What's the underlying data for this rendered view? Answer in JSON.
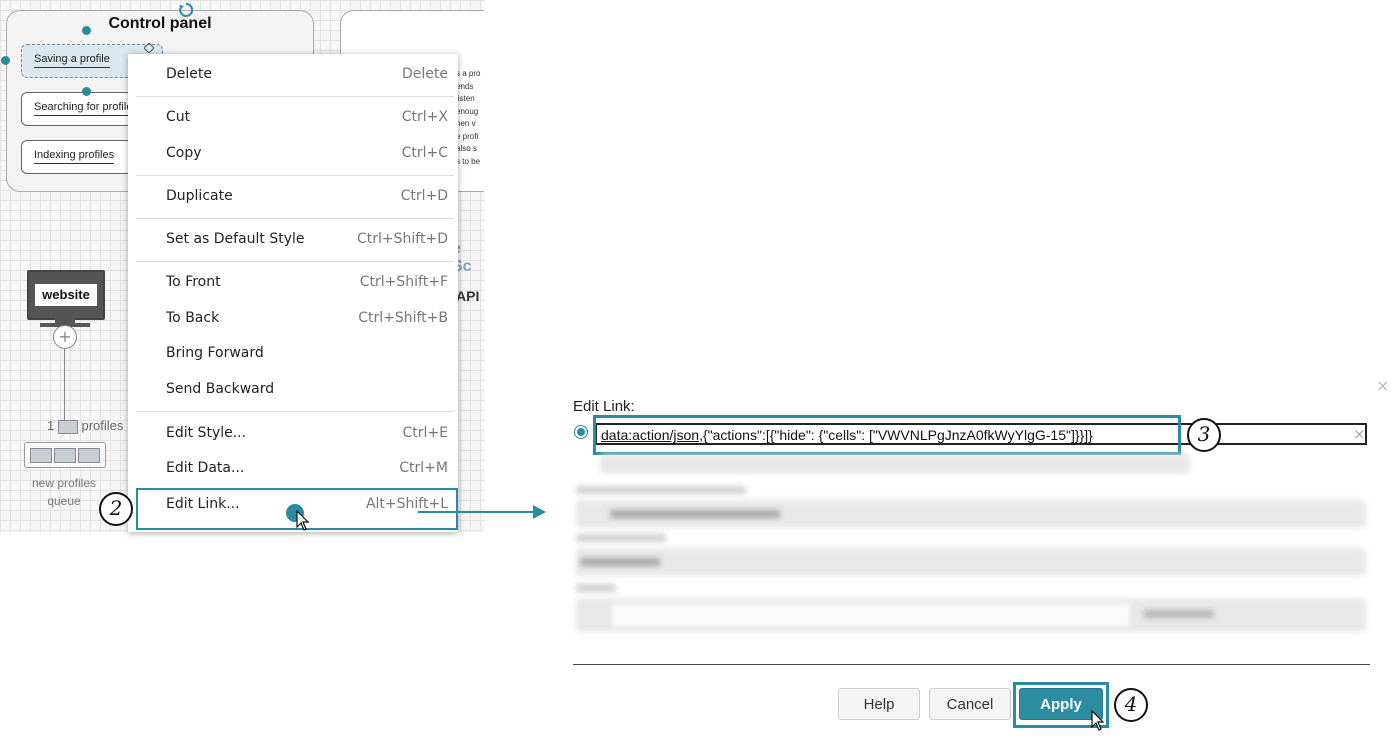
{
  "canvas": {
    "panel_title": "Control panel",
    "services": [
      "Saving a profile",
      "Searching for profiles",
      "Indexing profiles"
    ],
    "snippet_lines": [
      "s a pro",
      "ends",
      "listen",
      "enoug",
      "hen v",
      "e profi",
      "also s",
      "s to be"
    ],
    "fragment_1": "e Sc",
    "fragment_2": "API",
    "website_label": "website",
    "profiles_count": "1",
    "profiles_label": "profiles",
    "queue_label": "new profiles queue"
  },
  "context_menu": {
    "items": [
      {
        "label": "Delete",
        "shortcut": "Delete"
      },
      {
        "label": "Cut",
        "shortcut": "Ctrl+X"
      },
      {
        "label": "Copy",
        "shortcut": "Ctrl+C"
      },
      {
        "label": "Duplicate",
        "shortcut": "Ctrl+D"
      },
      {
        "label": "Set as Default Style",
        "shortcut": "Ctrl+Shift+D"
      },
      {
        "label": "To Front",
        "shortcut": "Ctrl+Shift+F"
      },
      {
        "label": "To Back",
        "shortcut": "Ctrl+Shift+B"
      },
      {
        "label": "Bring Forward",
        "shortcut": ""
      },
      {
        "label": "Send Backward",
        "shortcut": ""
      },
      {
        "label": "Edit Style...",
        "shortcut": "Ctrl+E"
      },
      {
        "label": "Edit Data...",
        "shortcut": "Ctrl+M"
      },
      {
        "label": "Edit Link...",
        "shortcut": "Alt+Shift+L"
      }
    ]
  },
  "steps": [
    "2",
    "3",
    "4"
  ],
  "dialog": {
    "title": "Edit Link:",
    "link_value_prefix": "data:action/json",
    "link_value_rest": ",{\"actions\":[{\"hide\": {\"cells\": [\"VWVNLPgJnzA0fkWyYlgG-15\"]}}]}",
    "close_symbol": "×",
    "clear_symbol": "×",
    "buttons": {
      "help": "Help",
      "cancel": "Cancel",
      "apply": "Apply"
    }
  },
  "colors": {
    "accent": "#2b8ca2",
    "highlight": "#2a8ca0"
  },
  "icons": [
    "rotate-handle-icon",
    "website-monitor-icon",
    "add-icon",
    "envelope-icon",
    "mouse-cursor-icon",
    "radio-selected-icon",
    "close-icon"
  ]
}
